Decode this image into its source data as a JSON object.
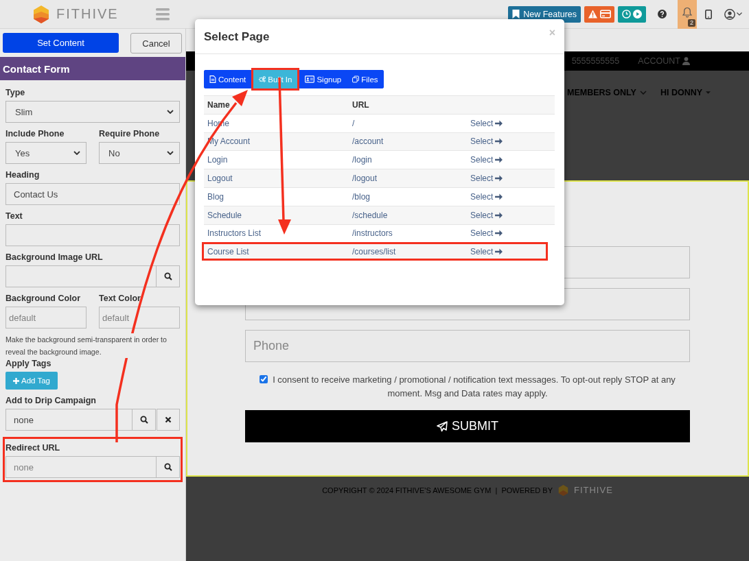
{
  "topbar": {
    "brand": "FITHIVE",
    "new_features": "New Features",
    "notification_count": "2"
  },
  "editor": {
    "buttons": [
      {
        "label": "Set Content",
        "kind": "primary"
      },
      {
        "label": "Cancel",
        "kind": "default"
      }
    ],
    "section_title": "Contact Form",
    "fields": [
      {
        "kind": "select",
        "label": "Type",
        "value": "Slim"
      },
      {
        "kind": "select",
        "label": "Include Phone",
        "value": "Yes",
        "half": true
      },
      {
        "kind": "select",
        "label": "Require Phone",
        "value": "No",
        "half": true
      },
      {
        "kind": "text",
        "label": "Heading",
        "value": "Contact Us"
      },
      {
        "kind": "text",
        "label": "Text"
      },
      {
        "kind": "lookup",
        "label": "Background Image URL"
      },
      {
        "kind": "text",
        "label": "Background Color",
        "placeholder": "default",
        "half": true
      },
      {
        "kind": "text",
        "label": "Text Color",
        "placeholder": "default",
        "half": true
      },
      {
        "kind": "note",
        "text": "Make the background semi-transparent in order to reveal the background image."
      },
      {
        "kind": "tags",
        "label": "Apply Tags",
        "button": "Add Tag"
      },
      {
        "kind": "lookup",
        "label": "Add to Drip Campaign",
        "value": "none",
        "clearable": true
      },
      {
        "kind": "lookup",
        "label": "Redirect URL",
        "placeholder": "none",
        "highlighted": true
      }
    ]
  },
  "site": {
    "phone": "5555555555",
    "account": "ACCOUNT",
    "nav": [
      "MEMBERS ONLY",
      "HI DONNY"
    ],
    "form": {
      "fields": [
        {
          "kind": "input"
        },
        {
          "kind": "input"
        },
        {
          "kind": "input",
          "placeholder": "Phone"
        }
      ],
      "consent": {
        "checked": true,
        "text": "I consent to receive marketing / promotional / notification text messages. To opt-out reply STOP at any moment. Msg and Data rates may apply."
      },
      "submit": "SUBMIT"
    },
    "footer": {
      "text": "COPYRIGHT © 2024 FITHIVE'S AWESOME GYM  |  POWERED BY",
      "brand": "FITHIVE"
    }
  },
  "modal": {
    "title": "Select Page",
    "close": "×",
    "tabs": [
      {
        "label": "Content",
        "selected": false,
        "highlighted": false
      },
      {
        "label": "Built In",
        "selected": true,
        "highlighted": true
      },
      {
        "label": "Signup",
        "selected": false,
        "highlighted": false
      },
      {
        "label": "Files",
        "selected": false,
        "highlighted": false
      }
    ],
    "columns": [
      "Name",
      "URL"
    ],
    "rows": [
      {
        "name": "Home",
        "url": "/",
        "action": "Select",
        "highlighted": false
      },
      {
        "name": "My Account",
        "url": "/account",
        "action": "Select",
        "highlighted": false
      },
      {
        "name": "Login",
        "url": "/login",
        "action": "Select",
        "highlighted": false
      },
      {
        "name": "Logout",
        "url": "/logout",
        "action": "Select",
        "highlighted": false
      },
      {
        "name": "Blog",
        "url": "/blog",
        "action": "Select",
        "highlighted": false
      },
      {
        "name": "Schedule",
        "url": "/schedule",
        "action": "Select",
        "highlighted": false
      },
      {
        "name": "Instructors List",
        "url": "/instructors",
        "action": "Select",
        "highlighted": false
      },
      {
        "name": "Course List",
        "url": "/courses/list",
        "action": "Select",
        "highlighted": true
      }
    ]
  }
}
